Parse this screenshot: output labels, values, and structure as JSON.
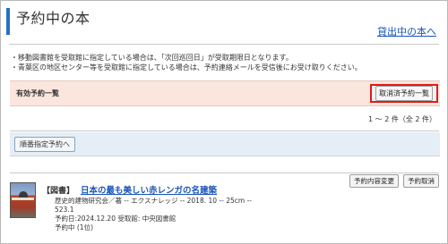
{
  "header": {
    "title": "予約中の本",
    "loan_link": "貸出中の本へ"
  },
  "notes": [
    "・移動図書館を受取館に指定している場合は、「次回巡回日」が受取期限日となります。",
    "・青葉区の地区センター等を受取館に指定している場合は、予約連絡メールを受信後にお受け取りください。"
  ],
  "active": {
    "label": "有効予約一覧",
    "cancelled_button": "取消済予約一覧"
  },
  "count_text": "1 ～ 2 件（全 2 件）",
  "order_button": "順番指定予約へ",
  "item": {
    "type": "【図書】",
    "title": "日本の最も美しい赤レンガの名建築",
    "meta_line1": "歴史的建物研究会／著 -- エクスナレッジ -- 2018. 10 -- 25cm --",
    "meta_line2": "523.1",
    "meta_line3": "予約日:2024.12.20 受取館: 中央図書館",
    "meta_line4": "予約中 (1位)",
    "change_button": "予約内容変更",
    "cancel_button": "予約取消"
  }
}
